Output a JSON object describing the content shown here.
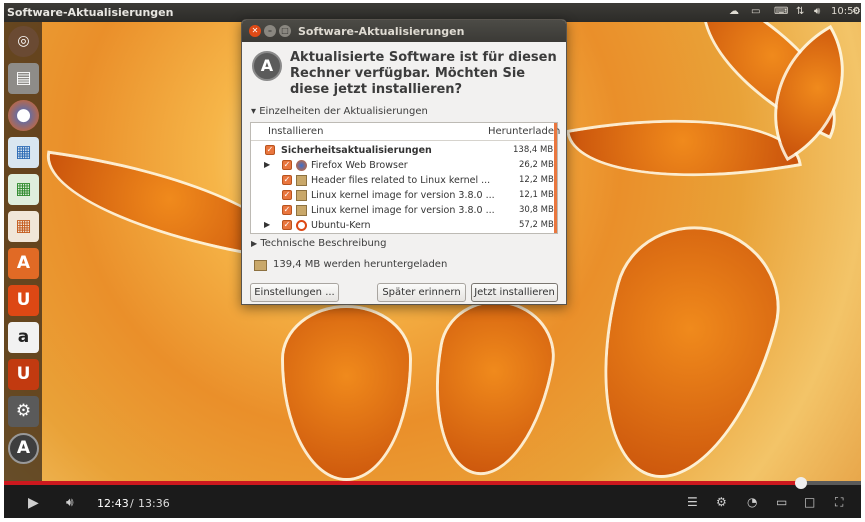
{
  "topbar": {
    "title": "Software-Aktualisierungen",
    "clock": "10:50"
  },
  "dialog": {
    "titlebar": "Software-Aktualisierungen",
    "heading": "Aktualisierte Software ist für diesen Rechner verfügbar. Möchten Sie diese jetzt installieren?",
    "details_expander": "Einzelheiten der Aktualisierungen",
    "columns": {
      "install": "Installieren",
      "download": "Herunterladen"
    },
    "rows": [
      {
        "label": "Sicherheitsaktualisierungen",
        "size": "138,4 MB"
      },
      {
        "label": "Firefox Web Browser",
        "size": "26,2 MB"
      },
      {
        "label": "Header files related to Linux kernel ...",
        "size": "12,2 MB"
      },
      {
        "label": "Linux kernel image for version 3.8.0 ...",
        "size": "12,1 MB"
      },
      {
        "label": "Linux kernel image for version 3.8.0 ...",
        "size": "30,8 MB"
      },
      {
        "label": "Ubuntu-Kern",
        "size": "57,2 MB"
      }
    ],
    "technical_expander": "Technische Beschreibung",
    "download_summary": "139,4 MB werden heruntergeladen",
    "buttons": {
      "settings": "Einstellungen ...",
      "later": "Später erinnern",
      "install": "Jetzt installieren"
    }
  },
  "player": {
    "current": "12:43",
    "separator": "/",
    "duration": "13:36",
    "progress": 0.93
  },
  "colors": {
    "accent": "#e9763e",
    "progress_red": "#cc181e",
    "panel": "#3c3b37"
  }
}
